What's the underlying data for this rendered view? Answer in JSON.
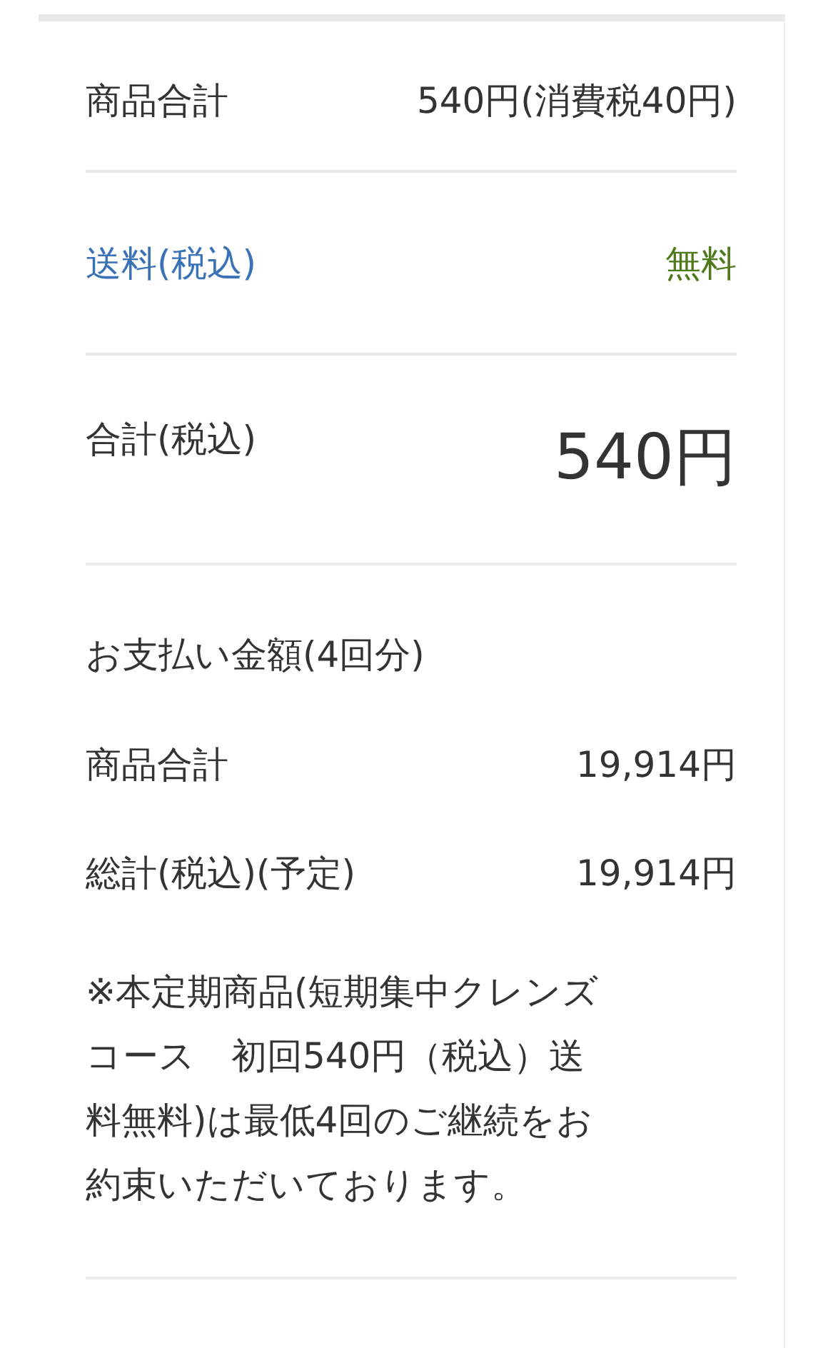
{
  "summary": {
    "label": "商品合計",
    "value": "540円(消費税40円)"
  },
  "shipping": {
    "label": "送料(税込)",
    "value": "無料"
  },
  "total": {
    "label": "合計(税込)",
    "value": "540円"
  },
  "payment": {
    "heading": "お支払い金額(4回分)",
    "rows": [
      {
        "label": "商品合計",
        "value": "19,914円"
      },
      {
        "label": "総計(税込)(予定)",
        "value": "19,914円"
      }
    ],
    "note": "※本定期商品(短期集中クレンズコース　初回540円（税込）送料無料)は最低4回のご継続をお約束いただいております。"
  }
}
